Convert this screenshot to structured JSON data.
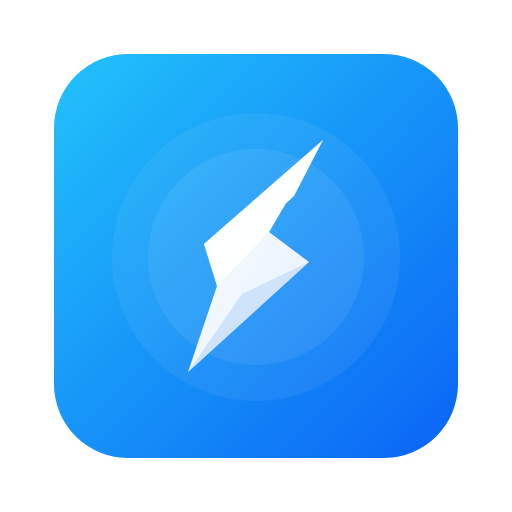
{
  "app_icon": {
    "icon": "lightning-bolt-icon",
    "colors": {
      "gradient_start": "#22c3fb",
      "gradient_end": "#0a63f5",
      "glow_ring": "#ffffff",
      "bolt_light": "#ffffff",
      "bolt_shade": "#cfe3fb"
    }
  }
}
